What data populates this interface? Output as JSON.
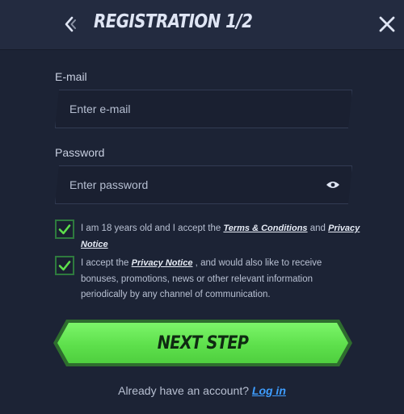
{
  "header": {
    "title": "REGISTRATION 1/2",
    "back_icon": "chevron-left-icon",
    "close_icon": "close-icon"
  },
  "form": {
    "email": {
      "label": "E-mail",
      "placeholder": "Enter e-mail",
      "value": ""
    },
    "password": {
      "label": "Password",
      "placeholder": "Enter password",
      "value": "",
      "toggle_icon": "eye-icon"
    },
    "consent_terms": {
      "checked": true,
      "text_before": "I am 18 years old and I accept the ",
      "terms_link": "Terms & Conditions",
      "text_mid": " and ",
      "privacy_link": "Privacy Notice"
    },
    "consent_marketing": {
      "checked": true,
      "text_before": "I accept the ",
      "privacy_link": "Privacy Notice",
      "text_after": " , and would also like to receive bonuses, promotions, news or other relevant information periodically by any channel of communication."
    },
    "next_button": "NEXT STEP"
  },
  "footer": {
    "prompt": "Already have an account? ",
    "login_link": "Log in"
  },
  "colors": {
    "background": "#1c2335",
    "header": "#232b40",
    "accent_green": "#5ee04c",
    "link_blue": "#3e9dff",
    "checkbox_green": "#2e7a3e"
  }
}
